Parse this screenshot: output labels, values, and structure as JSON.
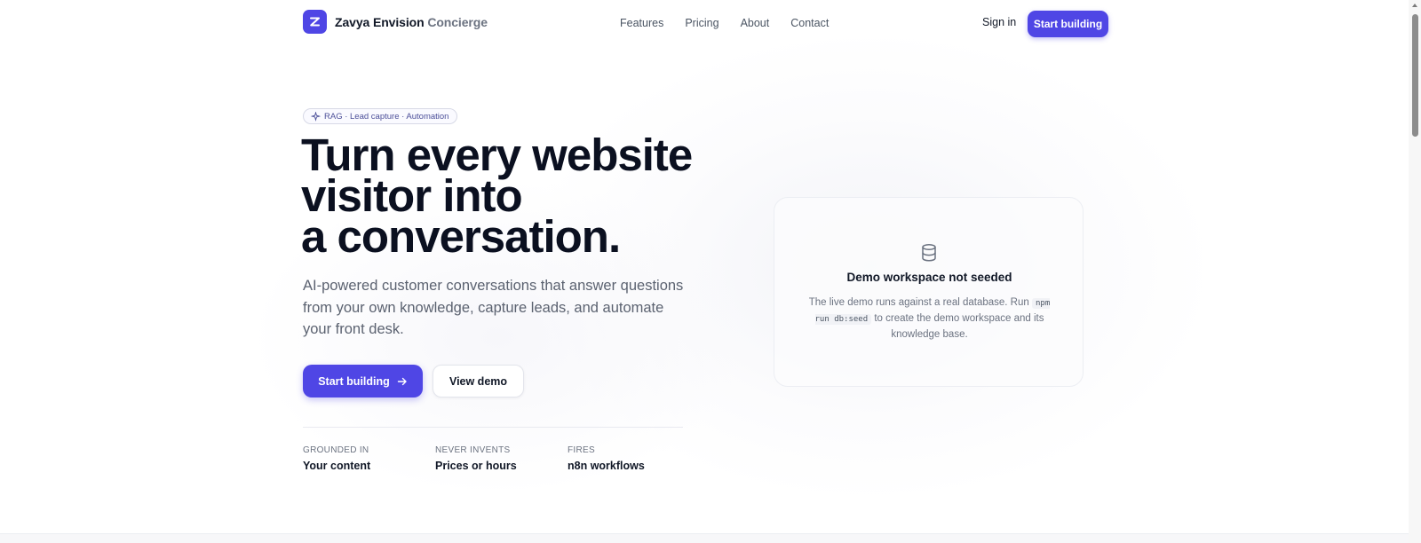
{
  "brand": {
    "name": "Zavya Envision",
    "suffix": "Concierge",
    "color": "#4f46e5",
    "logo_icon": "z-logo-icon"
  },
  "nav": {
    "links": [
      "Features",
      "Pricing",
      "About",
      "Contact"
    ],
    "signin": "Sign in",
    "cta": "Start building"
  },
  "hero": {
    "pill_icon": "sparkles-icon",
    "pill": "RAG · Lead capture · Automation",
    "headline": [
      "Turn every website",
      "visitor into",
      "a conversation."
    ],
    "lede": "AI-powered customer conversations that answer questions from your own knowledge, capture leads, and automate your front desk.",
    "primary_cta": "Start building",
    "primary_cta_icon": "arrow-right-icon",
    "secondary_cta": "View demo",
    "stats": [
      {
        "label": "GROUNDED IN",
        "value": "Your content"
      },
      {
        "label": "NEVER INVENTS",
        "value": "Prices or hours"
      },
      {
        "label": "FIRES",
        "value": "n8n workflows"
      }
    ]
  },
  "demo_card": {
    "icon": "database-icon",
    "title": "Demo workspace not seeded",
    "body_before": "The live demo runs against a real database. Run",
    "command": "npm run db:seed",
    "body_after": "to create the demo workspace and its knowledge base."
  }
}
